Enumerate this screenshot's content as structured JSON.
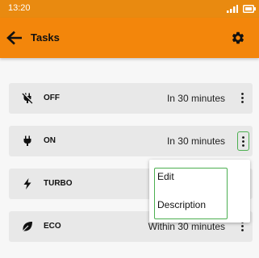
{
  "status_bar": {
    "time": "13:20"
  },
  "app_bar": {
    "title": "Tasks"
  },
  "tasks": [
    {
      "name": "OFF",
      "time": "In 30 minutes",
      "icon": "power-off-icon"
    },
    {
      "name": "ON",
      "time": "In 30 minutes",
      "icon": "power-plug-icon"
    },
    {
      "name": "TURBO",
      "time": "",
      "icon": "lightning-bolt-icon"
    },
    {
      "name": "ECO",
      "time": "Within 30 minutes",
      "icon": "leaf-icon"
    }
  ],
  "menu": {
    "items": [
      "Edit",
      "Description"
    ]
  },
  "colors": {
    "accent": "#f3860b",
    "status_bar": "#e98a10",
    "focus": "#4caf50",
    "card": "#e8e8e8",
    "background": "#f7f7f7"
  }
}
